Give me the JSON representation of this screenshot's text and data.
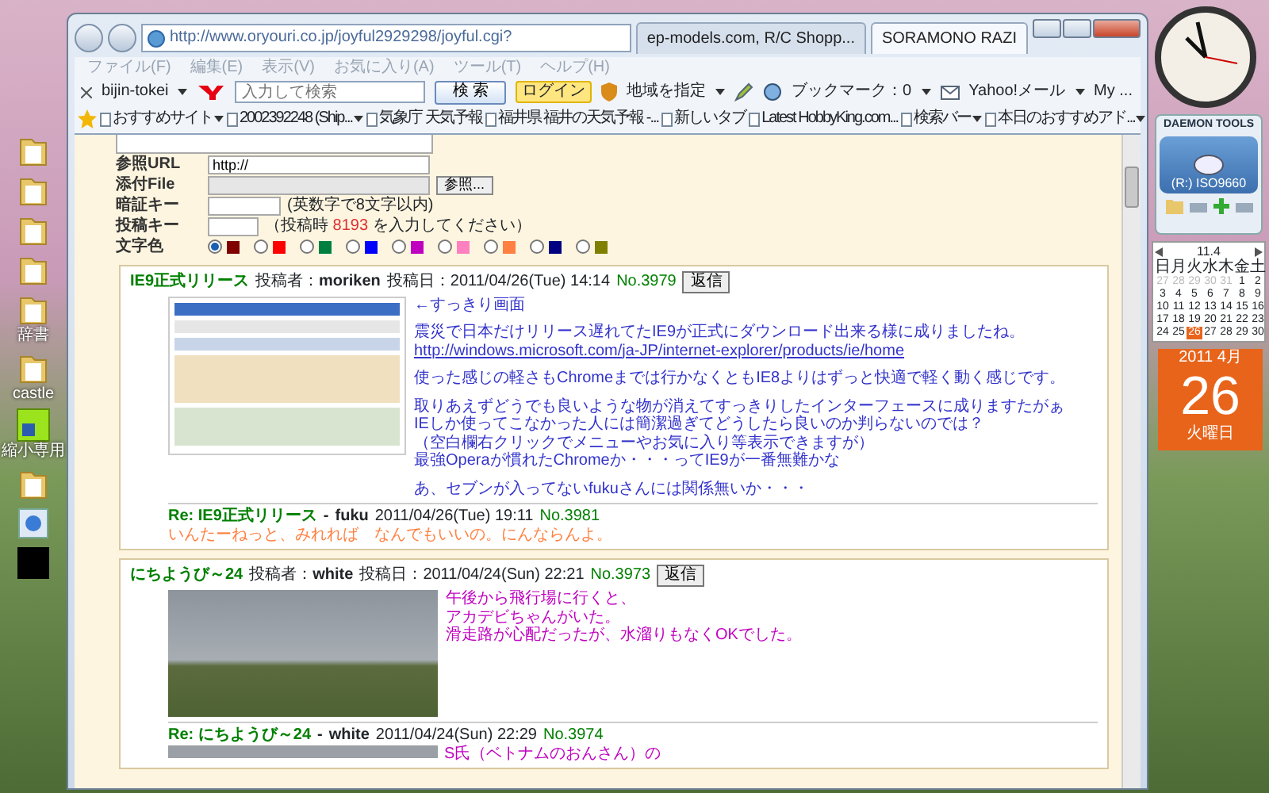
{
  "desktop_icons": [
    {
      "kind": "folder"
    },
    {
      "kind": "folder"
    },
    {
      "kind": "folder"
    },
    {
      "kind": "folder"
    },
    {
      "kind": "folder",
      "label": "辞書"
    },
    {
      "kind": "folder",
      "label": "castle"
    },
    {
      "kind": "app",
      "label": "縮小専用"
    },
    {
      "kind": "folder"
    },
    {
      "kind": "shortcut"
    },
    {
      "kind": "dark"
    }
  ],
  "browser": {
    "address": "http://www.oryouri.co.jp/joyful2929298/joyful.cgi?",
    "tabs": [
      {
        "label": "ep-models.com, R/C Shopp...",
        "selected": false
      },
      {
        "label": "SORAMONO RAZI",
        "selected": true
      }
    ],
    "menu": [
      "ファイル(F)",
      "編集(E)",
      "表示(V)",
      "お気に入り(A)",
      "ツール(T)",
      "ヘルプ(H)"
    ],
    "toolbar": {
      "profile": "bijin-tokei",
      "search_placeholder": "入力して検索",
      "search_button": "検 索",
      "login": "ログイン",
      "region": "地域を指定",
      "bookmark": "ブックマーク：0",
      "mail": "Yahoo!メール",
      "my": "My ..."
    },
    "favorites": [
      {
        "label": "おすすめサイト",
        "dropdown": true
      },
      {
        "label": "2002392248 (Ship...",
        "dropdown": true
      },
      {
        "label": "気象庁 天気予報",
        "dropdown": false
      },
      {
        "label": "福井県 福井の天気予報 -...",
        "dropdown": false
      },
      {
        "label": "新しいタブ",
        "dropdown": false
      },
      {
        "label": "Latest HobbyKing.com...",
        "dropdown": false
      },
      {
        "label": "検索バー",
        "dropdown": true
      },
      {
        "label": "本日のおすすめアド...",
        "dropdown": true
      }
    ]
  },
  "form": {
    "url_label": "参照URL",
    "url_value": "http://",
    "file_label": "添付File",
    "browse_button": "参照...",
    "password_label": "暗証キー",
    "password_note": "(英数字で8文字以内)",
    "post_key_label": "投稿キー",
    "post_key_note_before": "（投稿時",
    "post_key_code": "8193",
    "post_key_note_after": "を入力してください）",
    "color_label": "文字色",
    "colors": [
      {
        "color": "#800000",
        "selected": true
      },
      {
        "color": "#ff0000",
        "selected": false
      },
      {
        "color": "#008040",
        "selected": false
      },
      {
        "color": "#0000ff",
        "selected": false
      },
      {
        "color": "#c000c0",
        "selected": false
      },
      {
        "color": "#ff80c0",
        "selected": false
      },
      {
        "color": "#ff8040",
        "selected": false
      },
      {
        "color": "#000080",
        "selected": false
      },
      {
        "color": "#808000",
        "selected": false
      }
    ]
  },
  "posts": [
    {
      "title": "IE9正式リリース",
      "author_label": "投稿者：",
      "author": "moriken",
      "date_label": "投稿日：",
      "date": "2011/04/26(Tue) 14:14",
      "number": "No.3979",
      "reply_button": "返信",
      "image": {
        "kind": "screenshot"
      },
      "color": "#3333cc",
      "paragraphs": [
        [
          {
            "kind": "text",
            "text": "←すっきり画面"
          }
        ],
        [
          {
            "kind": "text",
            "text": "震災で日本だけリリース遅れてたIE9が正式にダウンロード出来る様に成りましたね。"
          },
          {
            "kind": "link",
            "text": "http://windows.microsoft.com/ja-JP/internet-explorer/products/ie/home"
          }
        ],
        [
          {
            "kind": "text",
            "text": "使った感じの軽さもChromeまでは行かなくともIE8よりはずっと快適で軽く動く感じです。"
          }
        ],
        [
          {
            "kind": "text",
            "text": "取りあえずどうでも良いような物が消えてすっきりしたインターフェースに成りますたがぁ"
          },
          {
            "kind": "text",
            "text": "IEしか使ってこなかった人には簡潔過ぎてどうしたら良いのか判らないのでは？"
          },
          {
            "kind": "text",
            "text": "（空白欄右クリックでメニューやお気に入り等表示できますが）"
          },
          {
            "kind": "text",
            "text": "最強Operaが慣れたChromeか・・・ってIE9が一番無難かな"
          }
        ],
        [
          {
            "kind": "text",
            "text": "あ、セブンが入ってないfukuさんには関係無いか・・・"
          }
        ]
      ],
      "replies": [
        {
          "title": "Re: IE9正式リリース",
          "separator": "-",
          "author": "fuku",
          "date": "2011/04/26(Tue) 19:11",
          "number": "No.3981",
          "color": "#ff8040",
          "lines": [
            "いんたーねっと、みれれば　なんでもいいの。にんならんよ。"
          ]
        }
      ]
    },
    {
      "title": "にちようび～24",
      "author_label": "投稿者：",
      "author": "white",
      "date_label": "投稿日：",
      "date": "2011/04/24(Sun) 22:21",
      "number": "No.3973",
      "reply_button": "返信",
      "image": {
        "kind": "photo"
      },
      "color": "#c000c0",
      "paragraphs": [
        [
          {
            "kind": "text",
            "text": "午後から飛行場に行くと、"
          },
          {
            "kind": "text",
            "text": "アカデビちゃんがいた。"
          },
          {
            "kind": "text",
            "text": "滑走路が心配だったが、水溜りもなくOKでした。"
          }
        ]
      ],
      "replies": [
        {
          "title": "Re: にちようび～24",
          "separator": "-",
          "author": "white",
          "date": "2011/04/24(Sun) 22:29",
          "number": "No.3974",
          "color": "#c000c0",
          "image": {
            "kind": "photo"
          },
          "lines": [
            "S氏（ベトナムのおんさん）の"
          ]
        }
      ]
    }
  ],
  "gadgets": {
    "drive": {
      "title": "DAEMON TOOLS",
      "label": "(R:) ISO9660"
    },
    "calendar": {
      "header": "11.4",
      "weekdays": [
        "日",
        "月",
        "火",
        "水",
        "木",
        "金",
        "土"
      ],
      "days": [
        {
          "text": "27",
          "muted": true,
          "selected": false
        },
        {
          "text": "28",
          "muted": true,
          "selected": false
        },
        {
          "text": "29",
          "muted": true,
          "selected": false
        },
        {
          "text": "30",
          "muted": true,
          "selected": false
        },
        {
          "text": "31",
          "muted": true,
          "selected": false
        },
        {
          "text": "1",
          "muted": false,
          "selected": false
        },
        {
          "text": "2",
          "muted": false,
          "selected": false
        },
        {
          "text": "3",
          "muted": false,
          "selected": false
        },
        {
          "text": "4",
          "muted": false,
          "selected": false
        },
        {
          "text": "5",
          "muted": false,
          "selected": false
        },
        {
          "text": "6",
          "muted": false,
          "selected": false
        },
        {
          "text": "7",
          "muted": false,
          "selected": false
        },
        {
          "text": "8",
          "muted": false,
          "selected": false
        },
        {
          "text": "9",
          "muted": false,
          "selected": false
        },
        {
          "text": "10",
          "muted": false,
          "selected": false
        },
        {
          "text": "11",
          "muted": false,
          "selected": false
        },
        {
          "text": "12",
          "muted": false,
          "selected": false
        },
        {
          "text": "13",
          "muted": false,
          "selected": false
        },
        {
          "text": "14",
          "muted": false,
          "selected": false
        },
        {
          "text": "15",
          "muted": false,
          "selected": false
        },
        {
          "text": "16",
          "muted": false,
          "selected": false
        },
        {
          "text": "17",
          "muted": false,
          "selected": false
        },
        {
          "text": "18",
          "muted": false,
          "selected": false
        },
        {
          "text": "19",
          "muted": false,
          "selected": false
        },
        {
          "text": "20",
          "muted": false,
          "selected": false
        },
        {
          "text": "21",
          "muted": false,
          "selected": false
        },
        {
          "text": "22",
          "muted": false,
          "selected": false
        },
        {
          "text": "23",
          "muted": false,
          "selected": false
        },
        {
          "text": "24",
          "muted": false,
          "selected": false
        },
        {
          "text": "25",
          "muted": false,
          "selected": false
        },
        {
          "text": "26",
          "muted": false,
          "selected": true
        },
        {
          "text": "27",
          "muted": false,
          "selected": false
        },
        {
          "text": "28",
          "muted": false,
          "selected": false
        },
        {
          "text": "29",
          "muted": false,
          "selected": false
        },
        {
          "text": "30",
          "muted": false,
          "selected": false
        }
      ]
    },
    "date_page": {
      "month": "2011 4月",
      "day": "26",
      "weekday": "火曜日"
    }
  }
}
